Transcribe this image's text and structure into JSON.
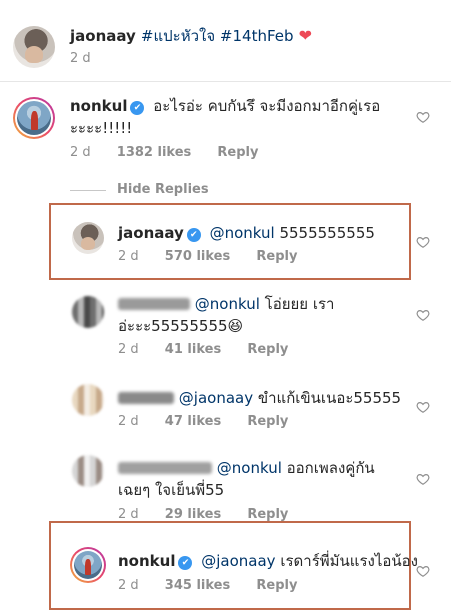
{
  "caption": {
    "username": "jaonaay",
    "text": "#แปะหัวใจ #14thFeb",
    "heart": "❤",
    "time": "2 d"
  },
  "comment": {
    "username": "nonkul",
    "text": "อะไรอ่ะ คบกันรึ จะมีงอกมาอีกคู่เรอ ะะะะ!!!!!",
    "time": "2 d",
    "likes": "1382 likes",
    "reply": "Reply",
    "hide_replies": "Hide Replies"
  },
  "replies": [
    {
      "username": "jaonaay",
      "mention": "@nonkul",
      "text": "5555555555",
      "time": "2 d",
      "likes": "570 likes",
      "reply": "Reply",
      "highlighted": true
    },
    {
      "username": "",
      "mention": "@nonkul",
      "text": "โอ่ยยย เรา อ่ะะะ55555555😆",
      "time": "2 d",
      "likes": "41 likes",
      "reply": "Reply",
      "blurred": true
    },
    {
      "username": "",
      "mention": "@jaonaay",
      "text": "ขำแก้เขินเนอะ55555",
      "time": "2 d",
      "likes": "47 likes",
      "reply": "Reply",
      "blurred": true
    },
    {
      "username": "",
      "mention": "@nonkul",
      "text": "ออกเพลงคู่กัน เฉยๆ ใจเย็นพี่55",
      "time": "2 d",
      "likes": "29 likes",
      "reply": "Reply",
      "blurred": true
    },
    {
      "username": "nonkul",
      "mention": "@jaonaay",
      "text": "เรดาร์พี่มันแรงไอน้อง",
      "time": "2 d",
      "likes": "345 likes",
      "reply": "Reply",
      "highlighted": true
    }
  ],
  "icons": {
    "heart": "heart-outline-icon",
    "verified": "verified-badge-icon"
  },
  "colors": {
    "mention": "#003569",
    "highlight_border": "#c0694a",
    "verified": "#3897f0",
    "caption_heart": "#ed4956"
  }
}
